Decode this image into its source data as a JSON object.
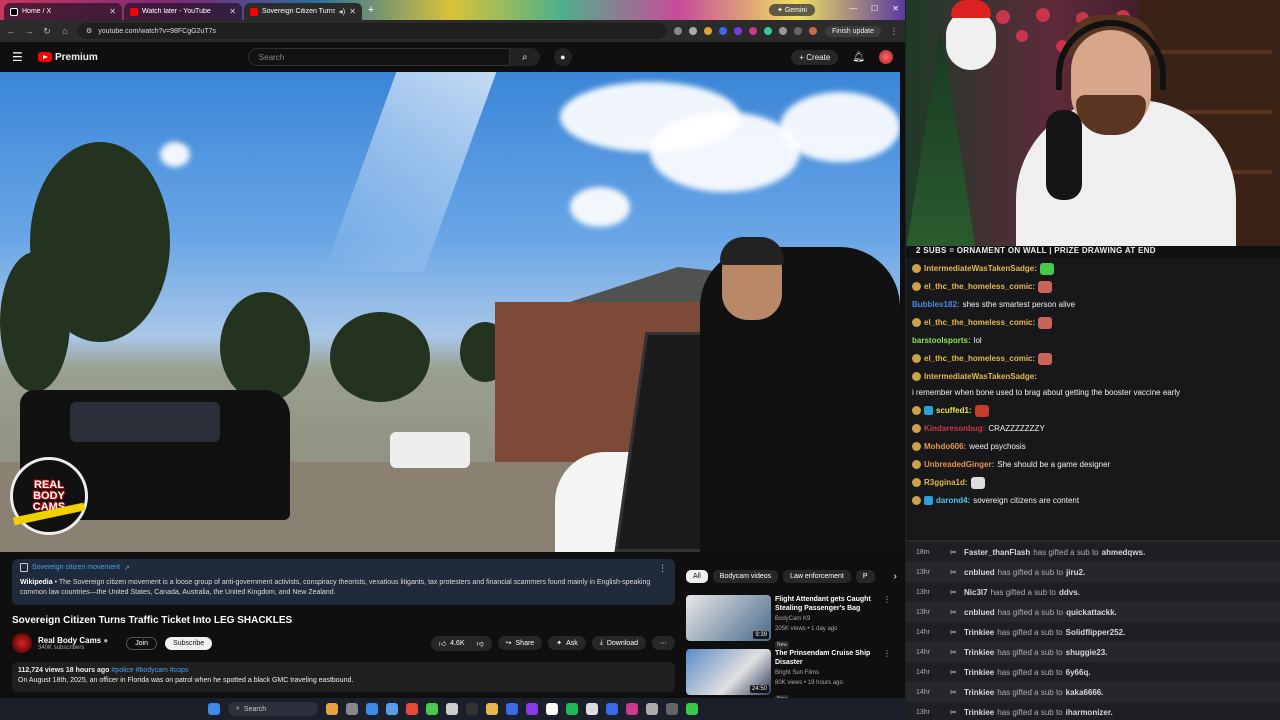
{
  "browser": {
    "tabs": [
      {
        "title": "Home / X",
        "color": "#000000"
      },
      {
        "title": "Watch later - YouTube",
        "color": "#ff0000"
      },
      {
        "title": "Sovereign Citizen Turns Tra",
        "color": "#ff0000"
      }
    ],
    "gemini_label": "Gemini",
    "url": "youtube.com/watch?v=98FCgG2uT7s",
    "finish_update": "Finish update"
  },
  "yt": {
    "logo_label": "Premium",
    "search_placeholder": "Search",
    "create_label": "Create"
  },
  "video": {
    "channel_watermark": [
      "REAL",
      "BODY",
      "CAMS"
    ]
  },
  "info_panel": {
    "title": "Sovereign citizen movement",
    "source": "Wikipedia",
    "text": " • The Sovereign citizen movement is a loose group of anti-government activists, conspiracy theorists, vexatious litigants, tax protesters and financial scammers found mainly in English-speaking common law countries—the United States, Canada, Australia, the United Kingdom, and New Zealand."
  },
  "video_title": "Sovereign Citizen Turns Traffic Ticket Into LEG SHACKLES",
  "channel": {
    "name": "Real Body Cams",
    "subs": "340K subscribers",
    "join": "Join",
    "subscribe": "Subscribe"
  },
  "actions": {
    "likes": "4.6K",
    "share": "Share",
    "ask": "Ask",
    "download": "Download"
  },
  "description": {
    "meta": "112,724 views  18 hours ago",
    "tags": "#police #bodycam #cops",
    "text": "On August 18th, 2025, an officer in Florida was on patrol when he spotted a black GMC traveling eastbound."
  },
  "chips": [
    "All",
    "Bodycam videos",
    "Law enforcement",
    "P"
  ],
  "recommendations": [
    {
      "title": "Flight Attendant gets Caught Stealing Passenger's Bag",
      "channel": "BodyCam K9",
      "meta": "205K views • 1 day ago",
      "badge": "New",
      "duration": "9:39",
      "thumb_color": "#4a6a8a"
    },
    {
      "title": "The Prinsendam Cruise Ship Disaster",
      "channel": "Bright Sun Films",
      "meta": "80K views • 19 hours ago",
      "badge": "New",
      "duration": "24:50",
      "thumb_color": "#3a6a9a"
    }
  ],
  "stream": {
    "banner": "2 SUBS = ORNAMENT ON WALL | PRIZE DRAWING AT END"
  },
  "chat": [
    {
      "user": "IntermediateWasTakenSadge:",
      "color": "#e6b84a",
      "text": "",
      "emote": "#4ac84a",
      "badge": "gold"
    },
    {
      "user": "el_thc_the_homeless_comic:",
      "color": "#e6b84a",
      "text": "",
      "emote": "#c8645a",
      "badge": "gold"
    },
    {
      "user": "Bubbles182:",
      "color": "#4a8ae6",
      "text": "shes sthe smartest person alive",
      "emote": "",
      "badge": ""
    },
    {
      "user": "el_thc_the_homeless_comic:",
      "color": "#e6b84a",
      "text": "",
      "emote": "#c8645a",
      "badge": "gold"
    },
    {
      "user": "barstoolsports:",
      "color": "#8ae64a",
      "text": "lol",
      "emote": "",
      "badge": ""
    },
    {
      "user": "el_thc_the_homeless_comic:",
      "color": "#e6b84a",
      "text": "",
      "emote": "#c8645a",
      "badge": "gold"
    },
    {
      "user": "IntermediateWasTakenSadge:",
      "color": "#e6b84a",
      "text": "i remember when bone used to brag about getting the booster vaccine early",
      "emote": "",
      "badge": "gold"
    },
    {
      "user": "scuffed1:",
      "color": "#e6e64a",
      "text": "",
      "emote": "#c83a2a",
      "badge": "gold-blue"
    },
    {
      "user": "Kindaresonbug:",
      "color": "#c83a4a",
      "text": "CRAZZZZZZZY",
      "emote": "",
      "badge": "gold"
    },
    {
      "user": "Mohdo606:",
      "color": "#e6944a",
      "text": "weed psychosis",
      "emote": "",
      "badge": "gold"
    },
    {
      "user": "UnbreadedGinger:",
      "color": "#e6944a",
      "text": "She should be a game designer",
      "emote": "",
      "badge": "gold"
    },
    {
      "user": "R3ggina1d:",
      "color": "#e6b84a",
      "text": "",
      "emote": "#dddddd",
      "badge": "gold"
    },
    {
      "user": "darond4:",
      "color": "#4ac8e6",
      "text": "sovereign citizens are content",
      "emote": "",
      "badge": "gold-blue"
    }
  ],
  "gifts": [
    {
      "time": "18m",
      "user": "Faster_thanFlash",
      "recipient": "ahmedqws.",
      "text": "has gifted a sub to"
    },
    {
      "time": "13hr",
      "user": "cnblued",
      "recipient": "jiru2.",
      "text": "has gifted a sub to"
    },
    {
      "time": "13hr",
      "user": "Nic3l7",
      "recipient": "ddvs.",
      "text": "has gifted a sub to"
    },
    {
      "time": "13hr",
      "user": "cnblued",
      "recipient": "quickattackk.",
      "text": "has gifted a sub to"
    },
    {
      "time": "14hr",
      "user": "Trinkiee",
      "recipient": "Solidflipper252.",
      "text": "has gifted a sub to"
    },
    {
      "time": "14hr",
      "user": "Trinkiee",
      "recipient": "shuggie23.",
      "text": "has gifted a sub to"
    },
    {
      "time": "14hr",
      "user": "Trinkiee",
      "recipient": "6y66q.",
      "text": "has gifted a sub to"
    },
    {
      "time": "14hr",
      "user": "Trinkiee",
      "recipient": "kaka6666.",
      "text": "has gifted a sub to"
    },
    {
      "time": "13hr",
      "user": "Trinkiee",
      "recipient": "iharmonizer.",
      "text": "has gifted a sub to"
    }
  ],
  "taskbar": {
    "search": "Search"
  }
}
